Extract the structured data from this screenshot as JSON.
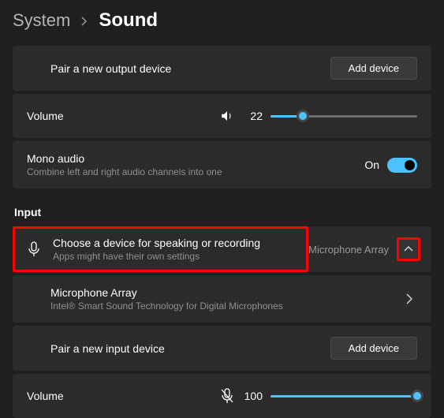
{
  "breadcrumb": {
    "parent": "System",
    "current": "Sound"
  },
  "output": {
    "pair_label": "Pair a new output device",
    "add_device": "Add device",
    "volume_label": "Volume",
    "volume_value": "22",
    "volume_percent": 22,
    "mono_title": "Mono audio",
    "mono_subtitle": "Combine left and right audio channels into one",
    "mono_state": "On"
  },
  "input": {
    "section_label": "Input",
    "choose_title": "Choose a device for speaking or recording",
    "choose_subtitle": "Apps might have their own settings",
    "selected_device": "Microphone Array",
    "device_title": "Microphone Array",
    "device_subtitle": "Intel® Smart Sound Technology for Digital Microphones",
    "pair_label": "Pair a new input device",
    "add_device": "Add device",
    "volume_label": "Volume",
    "volume_value": "100",
    "volume_percent": 100
  }
}
